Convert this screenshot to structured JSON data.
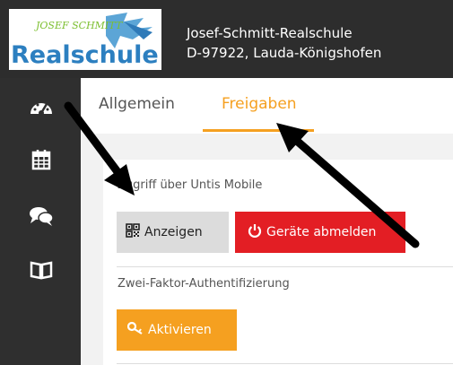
{
  "header": {
    "logo_text_top": "JOSEF SCHMITT",
    "logo_text_bottom": "Realschule",
    "school_line1": "Josef-Schmitt-Realschule",
    "school_line2": "D-97922, Lauda-Königshofen"
  },
  "sidebar": {
    "icons": [
      "dashboard-icon",
      "calendar-icon",
      "messages-icon",
      "book-icon"
    ]
  },
  "tabs": [
    {
      "label": "Allgemein",
      "active": false
    },
    {
      "label": "Freigaben",
      "active": true
    }
  ],
  "sections": {
    "untis_mobile": {
      "label": "Zugriff über Untis Mobile",
      "show_button": "Anzeigen",
      "logout_button": "Geräte abmelden"
    },
    "two_factor": {
      "label": "Zwei-Faktor-Authentifizierung",
      "activate_button": "Aktivieren"
    }
  },
  "colors": {
    "accent": "#f5a020",
    "danger": "#e31e24",
    "sidebar": "#2f2f2f",
    "annotation_arrow": "#000000"
  }
}
